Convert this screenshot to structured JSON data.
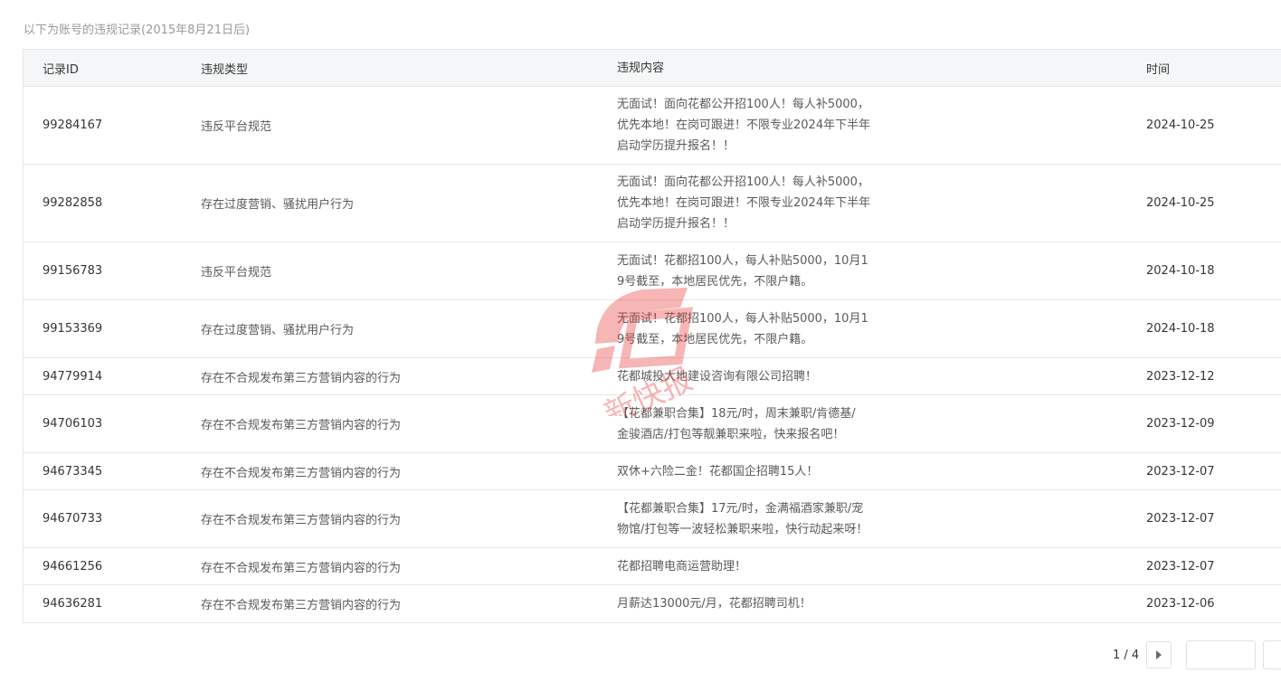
{
  "caption": "以下为账号的违规记录(2015年8月21日后)",
  "columns": {
    "id": "记录ID",
    "type": "违规类型",
    "content": "违规内容",
    "time": "时间"
  },
  "rows": [
    {
      "id": "99284167",
      "type": "违反平台规范",
      "content_lines": [
        "无面试！面向花都公开招100人！每人补5000，",
        "优先本地！在岗可跟进！不限专业2024年下半年",
        "启动学历提升报名！！"
      ],
      "time": "2024-10-25"
    },
    {
      "id": "99282858",
      "type": "存在过度营销、骚扰用户行为",
      "content_lines": [
        "无面试！面向花都公开招100人！每人补5000，",
        "优先本地！在岗可跟进！不限专业2024年下半年",
        "启动学历提升报名！！"
      ],
      "time": "2024-10-25"
    },
    {
      "id": "99156783",
      "type": "违反平台规范",
      "content_lines": [
        "无面试！花都招100人，每人补贴5000，10月1",
        "9号截至，本地居民优先，不限户籍。"
      ],
      "time": "2024-10-18"
    },
    {
      "id": "99153369",
      "type": "存在过度营销、骚扰用户行为",
      "content_lines": [
        "无面试！花都招100人，每人补贴5000，10月1",
        "9号截至，本地居民优先，不限户籍。"
      ],
      "time": "2024-10-18"
    },
    {
      "id": "94779914",
      "type": "存在不合规发布第三方营销内容的行为",
      "content_lines": [
        "花都城投大地建设咨询有限公司招聘！"
      ],
      "time": "2023-12-12"
    },
    {
      "id": "94706103",
      "type": "存在不合规发布第三方营销内容的行为",
      "content_lines": [
        "【花都兼职合集】18元/时，周末兼职/肯德基/",
        "金骏酒店/打包等靓兼职来啦，快来报名吧！"
      ],
      "time": "2023-12-09"
    },
    {
      "id": "94673345",
      "type": "存在不合规发布第三方营销内容的行为",
      "content_lines": [
        "双休+六险二金！花都国企招聘15人！"
      ],
      "time": "2023-12-07"
    },
    {
      "id": "94670733",
      "type": "存在不合规发布第三方营销内容的行为",
      "content_lines": [
        "【花都兼职合集】17元/时，金满福酒家兼职/宠",
        "物馆/打包等一波轻松兼职来啦，快行动起来呀！"
      ],
      "time": "2023-12-07"
    },
    {
      "id": "94661256",
      "type": "存在不合规发布第三方营销内容的行为",
      "content_lines": [
        "花都招聘电商运营助理！"
      ],
      "time": "2023-12-07"
    },
    {
      "id": "94636281",
      "type": "存在不合规发布第三方营销内容的行为",
      "content_lines": [
        "月薪达13000元/月，花都招聘司机！"
      ],
      "time": "2023-12-06"
    }
  ],
  "pagination": {
    "text": "1 / 4",
    "next_icon": "triangle-right-icon"
  },
  "watermark": {
    "text": "新快报",
    "color": "#e8312f"
  }
}
